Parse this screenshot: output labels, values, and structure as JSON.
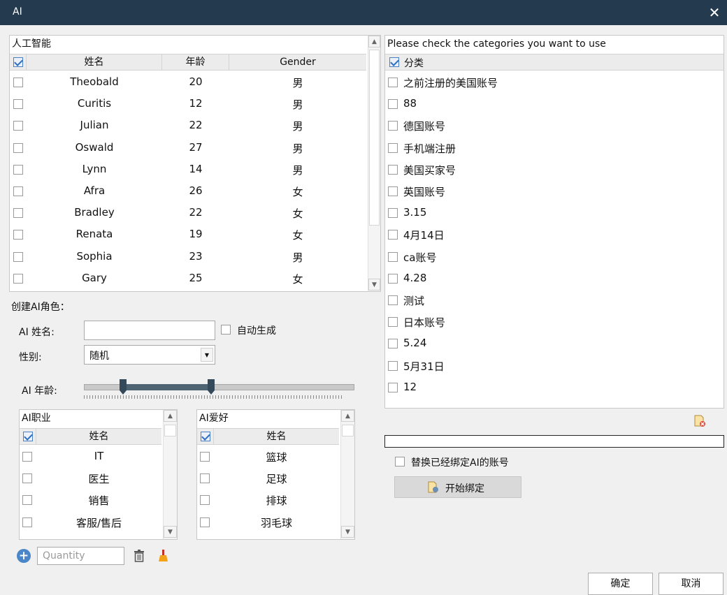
{
  "window": {
    "title": "AI",
    "close_icon": "close-icon"
  },
  "top_table": {
    "caption": "人工智能",
    "columns": [
      "姓名",
      "年龄",
      "Gender"
    ],
    "rows": [
      {
        "name": "Theobald",
        "age": "20",
        "gender": "男"
      },
      {
        "name": "Curitis",
        "age": "12",
        "gender": "男"
      },
      {
        "name": "Julian",
        "age": "22",
        "gender": "男"
      },
      {
        "name": "Oswald",
        "age": "27",
        "gender": "男"
      },
      {
        "name": "Lynn",
        "age": "14",
        "gender": "男"
      },
      {
        "name": "Afra",
        "age": "26",
        "gender": "女"
      },
      {
        "name": "Bradley",
        "age": "22",
        "gender": "女"
      },
      {
        "name": "Renata",
        "age": "19",
        "gender": "女"
      },
      {
        "name": "Sophia",
        "age": "23",
        "gender": "男"
      },
      {
        "name": "Gary",
        "age": "25",
        "gender": "女"
      }
    ]
  },
  "create": {
    "section_label": "创建AI角色：",
    "name_label": "AI 姓名:",
    "name_value": "",
    "auto_label": "自动生成",
    "gender_label": "性别:",
    "gender_value": "随机",
    "age_label": "AI 年龄:"
  },
  "job_table": {
    "caption": "AI职业",
    "column": "姓名",
    "rows": [
      "IT",
      "医生",
      "销售",
      "客服/售后"
    ]
  },
  "hobby_table": {
    "caption": "AI爱好",
    "column": "姓名",
    "rows": [
      "篮球",
      "足球",
      "排球",
      "羽毛球"
    ]
  },
  "bottom_tools": {
    "quantity_placeholder": "Quantity"
  },
  "categories": {
    "caption": "Please check the categories you want to use",
    "column": "分类",
    "rows": [
      "之前注册的美国账号",
      "88",
      "德国账号",
      "手机端注册",
      "美国买家号",
      "英国账号",
      "3.15",
      "4月14日",
      "ca账号",
      "4.28",
      "测试",
      "日本账号",
      "5.24",
      "5月31日",
      "12"
    ]
  },
  "bind": {
    "replace_label": "替换已经绑定AI的账号",
    "start_label": "开始绑定"
  },
  "footer": {
    "ok_label": "确定",
    "cancel_label": "取消"
  }
}
